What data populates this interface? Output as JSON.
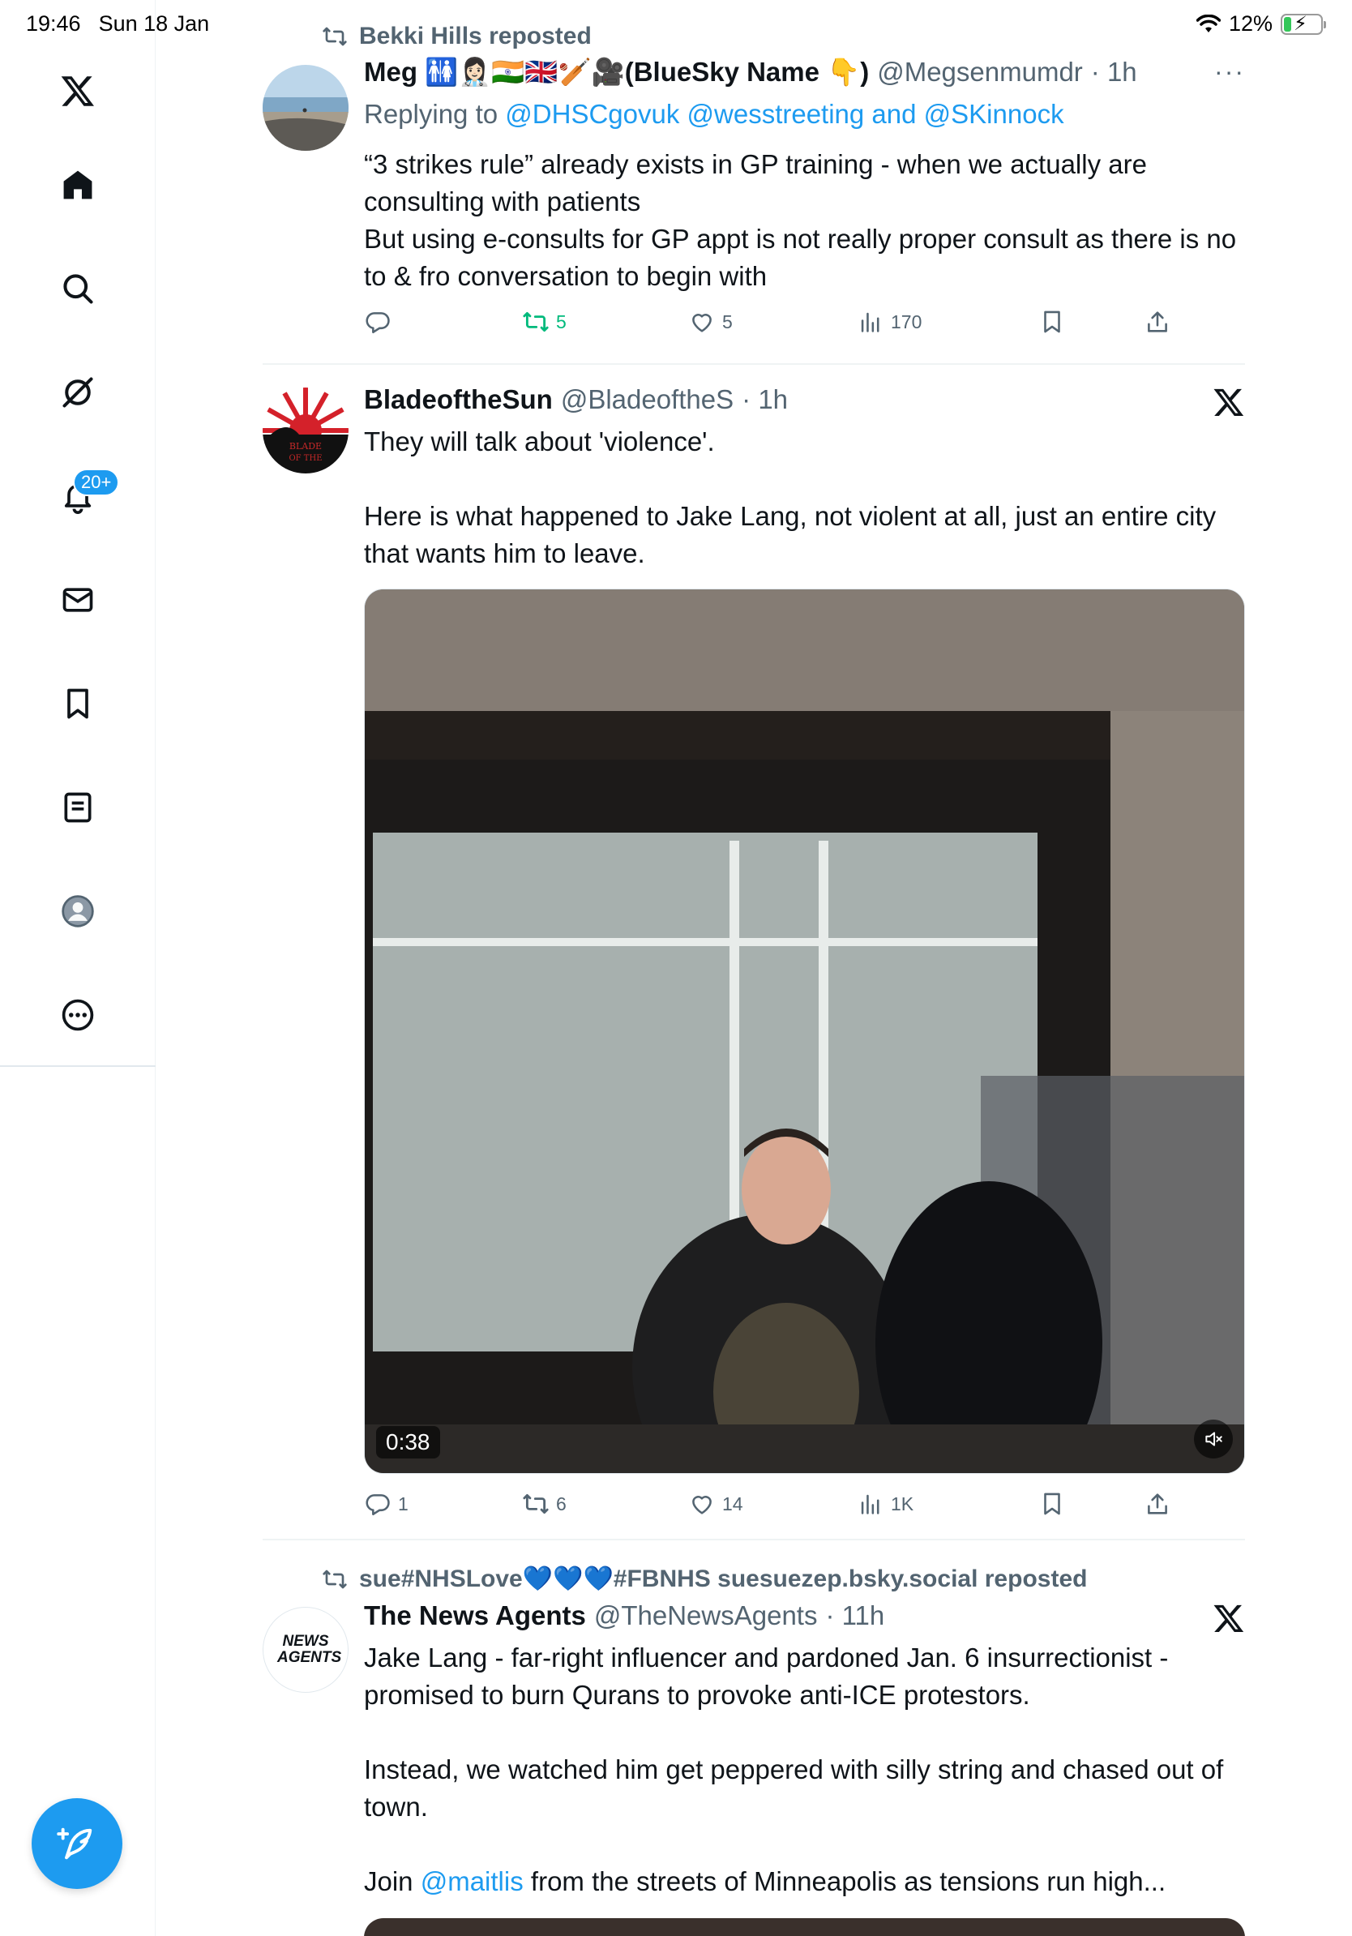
{
  "status_bar": {
    "time": "19:46",
    "date": "Sun 18 Jan",
    "battery": "12%"
  },
  "sidebar": {
    "notifications_badge": "20+",
    "items": [
      "x-logo",
      "home",
      "explore",
      "grok",
      "notifications",
      "messages",
      "bookmarks",
      "lists",
      "profile",
      "more"
    ]
  },
  "posts": [
    {
      "repost_by": "Bekki Hills reposted",
      "name": "Meg 🚻👩🏻‍⚕️🇮🇳🇬🇧🏏🎥(BlueSky Name 👇)",
      "handle": "@Megsenmumdr",
      "time": "· 1h",
      "reply_prefix": "Replying to",
      "reply_to": "@DHSCgovuk @wesstreeting and @SKinnock",
      "text_lines": [
        "“3 strikes rule” already exists in GP training - when we actually are consulting with patients",
        "But using e-consults for GP appt is not really proper consult as there is no to & fro conversation to begin with"
      ],
      "stats": {
        "replies": "",
        "reposts": "5",
        "likes": "5",
        "views": "170"
      }
    },
    {
      "name": "BladeoftheSun",
      "handle": "@BladeoftheS",
      "time": "· 1h",
      "text_lines": [
        "They will talk about 'violence'.",
        "Here is what happened to Jake Lang, not violent at all, just an entire city that wants him to leave."
      ],
      "video_duration": "0:38",
      "stats": {
        "replies": "1",
        "reposts": "6",
        "likes": "14",
        "views": "1K"
      }
    },
    {
      "repost_by": "sue#NHSLove💙💙💙#FBNHS suesuezep.bsky.social reposted",
      "name": "The News Agents",
      "handle": "@TheNewsAgents",
      "time": "· 11h",
      "avatar_text": "NEWS AGENTS",
      "text_lines": [
        "Jake Lang - far-right influencer and pardoned Jan. 6 insurrectionist - promised to burn Qurans to provoke anti-ICE protestors.",
        "Instead, we watched him get peppered with silly string and chased out of town."
      ],
      "join_prefix": "Join",
      "mention": "@maitlis",
      "join_suffix": "from the streets of Minneapolis as tensions run high..."
    }
  ],
  "colors": {
    "accent": "#1d9bf0",
    "repost_green": "#00ba7c",
    "muted": "#536471"
  }
}
